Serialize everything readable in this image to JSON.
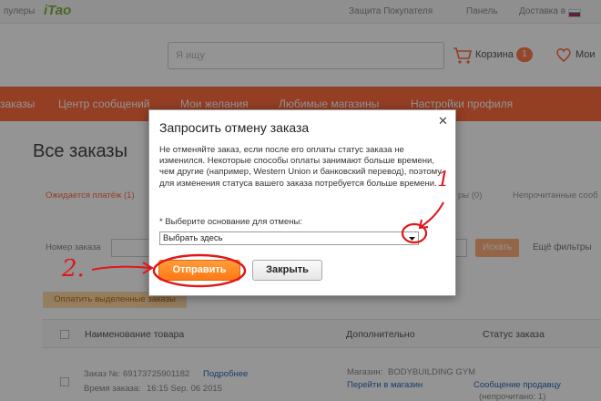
{
  "topbar": {
    "left_text": "пулеры",
    "logo": "iTao",
    "protection": "Защита Покупателя",
    "panel": "Панель",
    "delivery": "Доставка в"
  },
  "header": {
    "search_placeholder": "Я ищу",
    "cart_label": "Корзина",
    "cart_count": "1",
    "wishlist_label": "Мои"
  },
  "nav": {
    "items": [
      "заказы",
      "Центр сообщений",
      "Мои желания",
      "Любимые магазины",
      "Настройки профиля"
    ]
  },
  "page": {
    "title": "Все заказы",
    "tabs": [
      "Ожидается платёж (1)",
      "ры (0)",
      "Непрочитанные сооб"
    ],
    "filter_label": "Номер заказа",
    "search_button": "Искать",
    "all_filters": "Ещё фильтры",
    "confirm_button": "Оплатить выделенные заказы"
  },
  "table": {
    "headers": [
      "Наименование товара",
      "Дополнительно",
      "Статус заказа"
    ],
    "row": {
      "order_no_label": "Заказ №:",
      "order_no": "69173725901182",
      "details_link": "Подробнее",
      "time_label": "Время заказа:",
      "time": "16:15 Sep. 06 2015",
      "seller_label": "Магазин:",
      "seller": "BODYBUILDING GYM",
      "store_link": "Перейти в магазин",
      "message_link": "Сообщение продавцу",
      "unread": "(непрочитано: 1)"
    }
  },
  "modal": {
    "title": "Запросить отмену заказа",
    "info": "Не отменяйте заказ, если после его оплаты статус заказа не изменился. Некоторые способы оплаты занимают больше времени, чем другие (например, Western Union и банковский перевод), поэтому для изменения статуса вашего заказа потребуется больше времени.",
    "reason_label": "* Выберите основание для отмены:",
    "reason_value": "Выбрать здесь",
    "send_button": "Отправить",
    "close_button": "Закрыть"
  },
  "annotations": {
    "mark_1": "1",
    "mark_2": "2."
  },
  "colors": {
    "accent": "#ff6b3f",
    "send_button": "#ff8a24",
    "annotation": "#e0161b"
  }
}
